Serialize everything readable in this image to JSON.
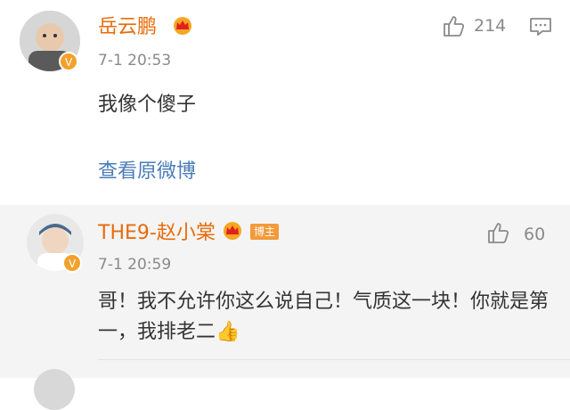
{
  "post": {
    "author": "岳云鹏",
    "time": "7-1 20:53",
    "text": "我像个傻子",
    "likes": "214",
    "view_original": "查看原微博"
  },
  "reply": {
    "author": "THE9-赵小棠",
    "tag": "博主",
    "time": "7-1 20:59",
    "text": "哥！我不允许你这么说自己！气质这一块！你就是第一，我排老二👍",
    "likes": "60"
  },
  "colors": {
    "name": "#e86b0a",
    "link": "#4a7cb8",
    "badge": "#f2a12b",
    "reply_bg": "#f4f4f4"
  }
}
